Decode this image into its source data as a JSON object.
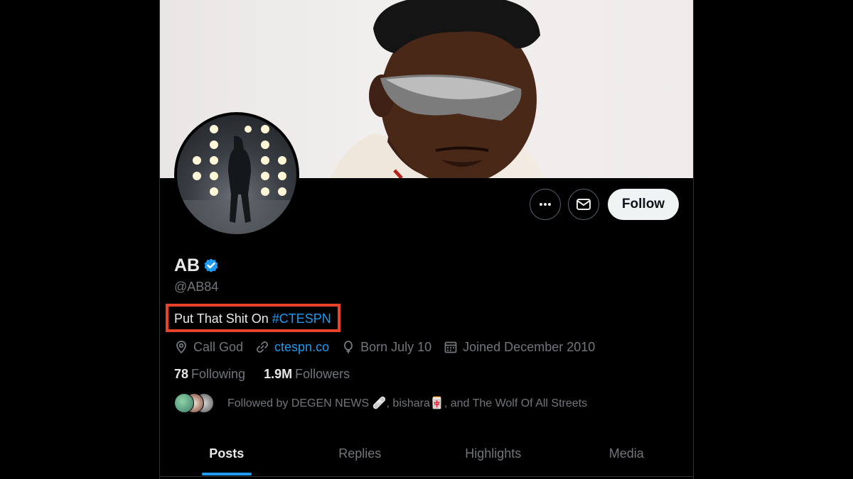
{
  "profile": {
    "display_name": "AB",
    "verified": true,
    "handle": "@AB84",
    "bio_text": "Put That Shit On ",
    "bio_hashtag": "#CTESPN",
    "location": "Call God",
    "website": "ctespn.co",
    "birthday": "Born July 10",
    "joined": "Joined December 2010"
  },
  "actions": {
    "more_icon": "more-horizontal-icon",
    "message_icon": "mail-icon",
    "follow_label": "Follow"
  },
  "stats": {
    "following_count": "78",
    "following_label": "Following",
    "followers_count": "1.9M",
    "followers_label": "Followers"
  },
  "followed_by": {
    "text": "Followed by DEGEN NEWS 🩹, bishara🀄, and The Wolf Of All Streets"
  },
  "tabs": [
    {
      "label": "Posts",
      "active": true
    },
    {
      "label": "Replies",
      "active": false
    },
    {
      "label": "Highlights",
      "active": false
    },
    {
      "label": "Media",
      "active": false
    }
  ],
  "colors": {
    "background": "#000000",
    "accent": "#1d9bf0",
    "highlight_box": "#e8432a",
    "muted_text": "#71767b"
  }
}
